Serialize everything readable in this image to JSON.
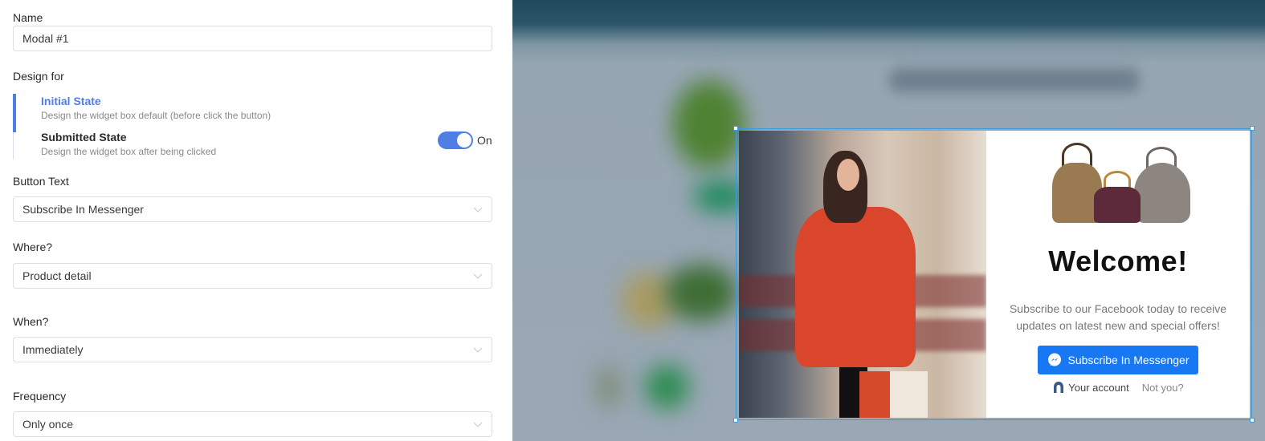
{
  "settings": {
    "name": {
      "label": "Name",
      "value": "Modal #1"
    },
    "design_for": {
      "label": "Design for",
      "states": [
        {
          "title": "Initial State",
          "description": "Design the widget box default (before click the button)",
          "active": true
        },
        {
          "title": "Submitted State",
          "description": "Design the widget box after being clicked",
          "active": false
        }
      ],
      "toggle": {
        "state": "on",
        "label": "On"
      }
    },
    "button_text": {
      "label": "Button Text",
      "value": "Subscribe In Messenger"
    },
    "where": {
      "label": "Where?",
      "value": "Product detail"
    },
    "when": {
      "label": "When?",
      "value": "Immediately"
    },
    "frequency": {
      "label": "Frequency",
      "value": "Only once"
    }
  },
  "preview": {
    "modal": {
      "heading": "Welcome!",
      "body": "Subscribe to our Facebook today to receive updates on latest new and special offers!",
      "button_label": "Subscribe In Messenger",
      "account_label": "Your account",
      "not_you_label": "Not you?"
    }
  },
  "colors": {
    "accent": "#4f7ee5",
    "messenger_blue": "#1877f2",
    "selection_border": "#3c99dc"
  },
  "icons": {
    "chevron": "chevron-down-icon",
    "messenger": "messenger-icon",
    "account": "user-icon"
  }
}
